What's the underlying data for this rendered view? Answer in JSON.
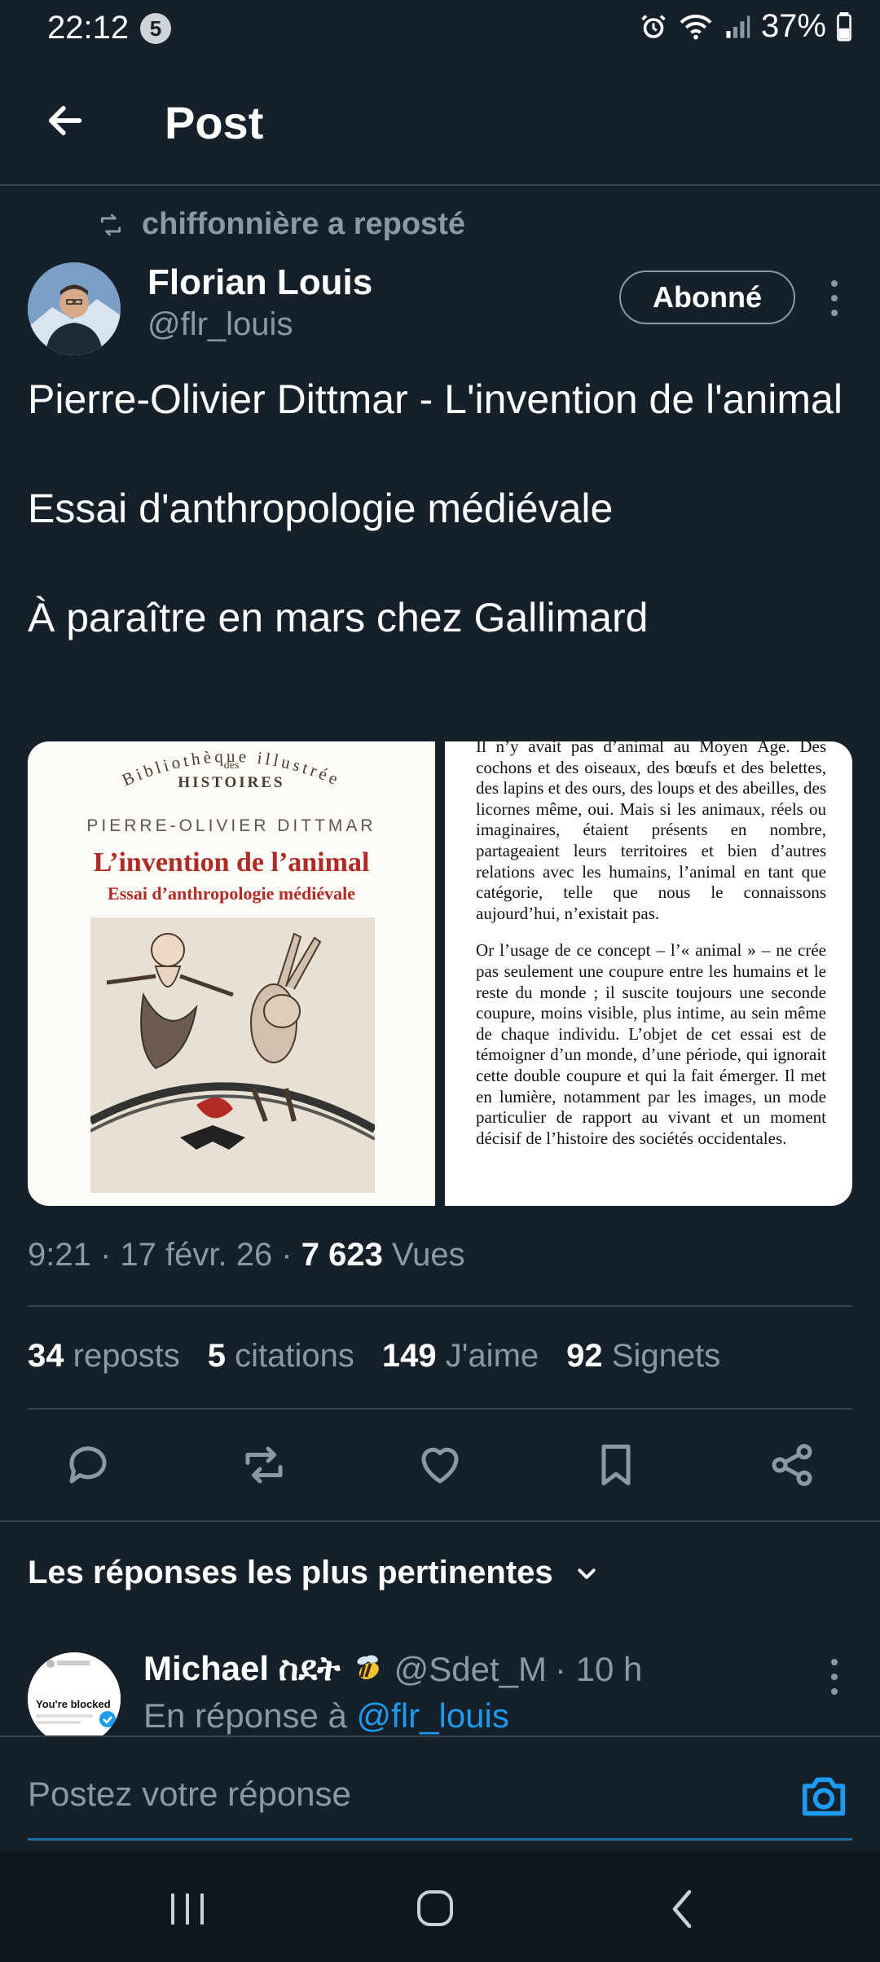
{
  "status_bar": {
    "time": "22:12",
    "notification_count": "5",
    "battery": "37%"
  },
  "header": {
    "title": "Post"
  },
  "repost": {
    "text": "chiffonnière a reposté"
  },
  "author": {
    "name": "Florian Louis",
    "handle": "@flr_louis",
    "follow_label": "Abonné"
  },
  "post": {
    "line1": "Pierre-Olivier Dittmar - L'invention de l'animal",
    "line2": "Essai d'anthropologie médiévale",
    "line3": "À paraître en mars chez Gallimard"
  },
  "media": {
    "cover_series_top": "Bibliothèque illustrée",
    "cover_series_des": "des",
    "cover_series_name": "HISTOIRES",
    "cover_author": "PIERRE-OLIVIER DITTMAR",
    "cover_title": "L’invention de l’animal",
    "cover_subtitle": "Essai d’anthropologie médiévale",
    "back_p1": "Il n’y avait pas d’animal au Moyen Âge. Des cochons et des oiseaux, des bœufs et des belettes, des lapins et des ours, des loups et des abeilles, des licornes même, oui. Mais si les animaux, réels ou imaginaires, étaient présents en nombre, partageaient leurs territoires et bien d’autres relations avec les humains, l’animal en tant que catégorie, telle que nous le connaissons aujourd’hui, n’existait pas.",
    "back_p2": "Or l’usage de ce concept – l’« animal » – ne crée pas seulement une coupure entre les humains et le reste du monde ; il suscite toujours une seconde coupure, moins visible, plus intime, au sein même de chaque individu. L’objet de cet essai est de témoigner d’un monde, d’une période, qui ignorait cette double coupure et qui la fait émerger. Il met en lumière, notamment par les images, un mode particulier de rapport au vivant et un moment décisif de l’histoire des sociétés occidentales."
  },
  "meta": {
    "time_date": "9:21 · 17 févr. 26 · ",
    "views_count": "7 623",
    "views_label": " Vues"
  },
  "stats": {
    "reposts_count": "34",
    "reposts_label": "reposts",
    "quotes_count": "5",
    "quotes_label": "citations",
    "likes_count": "149",
    "likes_label": "J'aime",
    "bookmarks_count": "92",
    "bookmarks_label": "Signets"
  },
  "replies": {
    "sort_label": "Les réponses les plus pertinentes",
    "first": {
      "name": "Michael ስደት",
      "handle": "@Sdet_M",
      "time": "· 10 h",
      "in_reply_prefix": "En réponse à ",
      "in_reply_handle": "@flr_louis",
      "avatar_text": "You're blocked"
    }
  },
  "composer": {
    "placeholder": "Postez votre réponse"
  },
  "colors": {
    "background": "#15202b",
    "accent": "#1d9bf0",
    "muted": "#8b98a5",
    "divider": "#38444d"
  },
  "icons": [
    "back-arrow-icon",
    "repost-icon",
    "reply-icon",
    "like-icon",
    "bookmark-icon",
    "share-icon",
    "chevron-down-icon",
    "camera-icon",
    "more-icon"
  ]
}
